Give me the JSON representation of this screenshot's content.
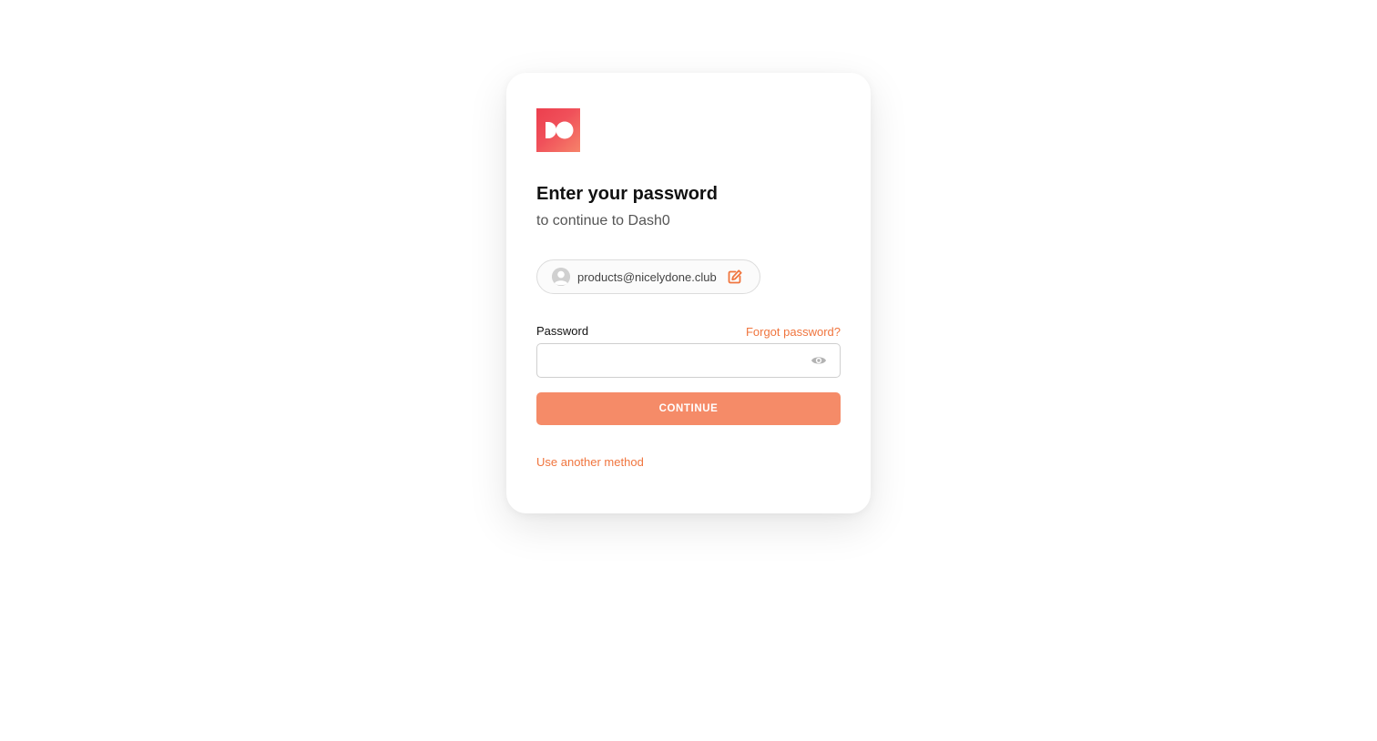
{
  "brand": {
    "logo_icon": "dash0-logo-icon",
    "accent_color": "#f0753e",
    "button_color": "#f58b68"
  },
  "header": {
    "title": "Enter your password",
    "subtitle": "to continue to Dash0"
  },
  "identity": {
    "avatar_icon": "user-avatar-icon",
    "email": "products@nicelydone.club",
    "edit_icon": "edit-icon"
  },
  "password": {
    "label": "Password",
    "forgot_link": "Forgot password?",
    "value": "",
    "placeholder": "",
    "toggle_icon": "eye-icon"
  },
  "actions": {
    "continue_label": "CONTINUE",
    "alt_method_link": "Use another method"
  }
}
